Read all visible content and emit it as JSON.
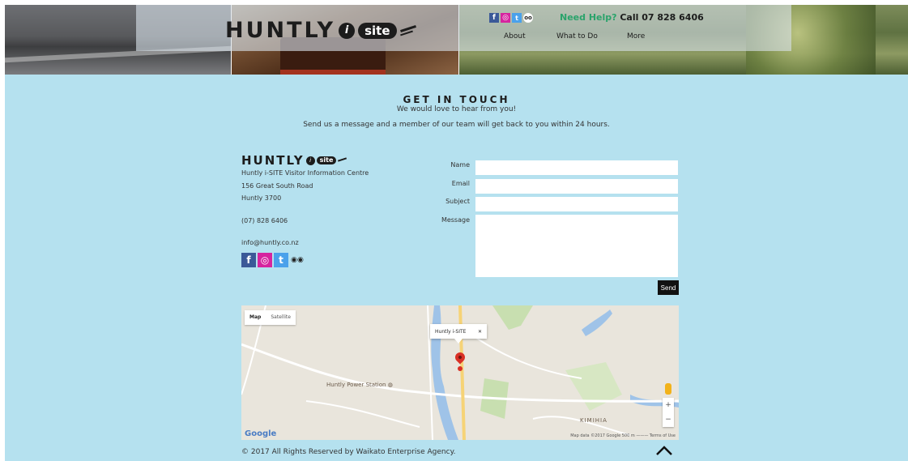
{
  "header": {
    "brand_word": "HUNTLY",
    "brand_i": "i",
    "brand_site": "site",
    "need_help": "Need Help?",
    "call": " Call 07 828 6406",
    "nav": [
      "About",
      "What to Do",
      "More"
    ],
    "social_icons": [
      "facebook-icon",
      "instagram-icon",
      "twitter-icon",
      "tripadvisor-icon"
    ]
  },
  "contact": {
    "title": "GET IN TOUCH",
    "subtitle": "We would love to hear from you!",
    "description": "Send us a message and a member of our team will get back to you within 24 hours."
  },
  "address": {
    "brand_word": "HUNTLY",
    "brand_i": "i",
    "brand_site": "site",
    "name": "Huntly i-SITE Visitor Information Centre",
    "street": "156 Great South Road",
    "city": "Huntly 3700",
    "phone": "(07) 828 6406",
    "email": "info@huntly.co.nz"
  },
  "form": {
    "name_label": "Name",
    "email_label": "Email",
    "subject_label": "Subject",
    "message_label": "Message",
    "name_value": "",
    "email_value": "",
    "subject_value": "",
    "message_value": "",
    "send_label": "Send"
  },
  "map": {
    "map_btn": "Map",
    "satellite_btn": "Satellite",
    "info_label": "Huntly i-SITE",
    "info_close": "✕",
    "poi_power_station": "Huntly Power Station ◍",
    "poi_kimihia": "KIMIHIA",
    "google": "Google",
    "footer": "Map data ©2017 Google   500 m ———   Terms of Use",
    "zoom_in": "+",
    "zoom_out": "−"
  },
  "footer": {
    "copyright": "© 2017 All Rights Reserved by Waikato Enterprise Agency."
  },
  "colors": {
    "content_bg": "#b5e1ef",
    "accent_green": "#2aa36b",
    "facebook": "#3b5998",
    "instagram": "#d6249f",
    "twitter": "#4aa1eb"
  }
}
